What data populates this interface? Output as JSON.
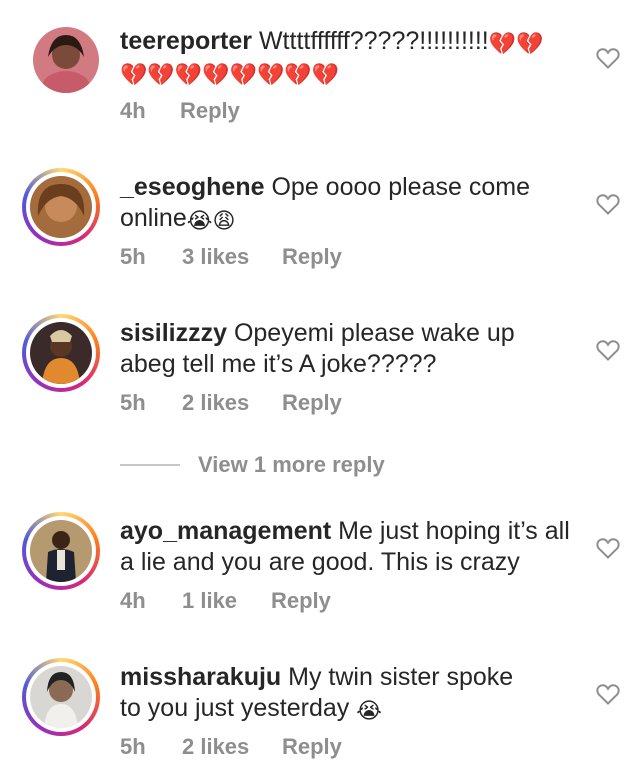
{
  "comments": [
    {
      "username": "teereporter",
      "text": "Wttttffffff?????!!!!!!!!!!",
      "emoji_trailing": "💔💔",
      "emoji_line2": "💔💔💔💔💔💔💔💔",
      "time": "4h",
      "likes": "",
      "reply": "Reply"
    },
    {
      "username": "_eseoghene",
      "text": "Ope oooo please come online",
      "emoji": "😭😩",
      "time": "5h",
      "likes": "3 likes",
      "reply": "Reply"
    },
    {
      "username": "sisilizzzy",
      "text": "Opeyemi please wake up abeg tell me it’s A joke?????",
      "time": "5h",
      "likes": "2 likes",
      "reply": "Reply"
    },
    {
      "username": "ayo_management",
      "text": "Me just hoping it’s all a lie and you are good. This is crazy",
      "time": "4h",
      "likes": "1 like",
      "reply": "Reply"
    },
    {
      "username": "missharakuju",
      "text": "My twin sister spoke to you just yesterday",
      "emoji": "😭",
      "time": "5h",
      "likes": "2 likes",
      "reply": "Reply"
    }
  ],
  "view_more_replies": "View 1 more reply",
  "icons": {
    "like": "heart-outline-icon"
  },
  "colors": {
    "primary_text": "#262626",
    "secondary_text": "#8e8e8e",
    "heart_stroke": "#8e8e8e"
  }
}
